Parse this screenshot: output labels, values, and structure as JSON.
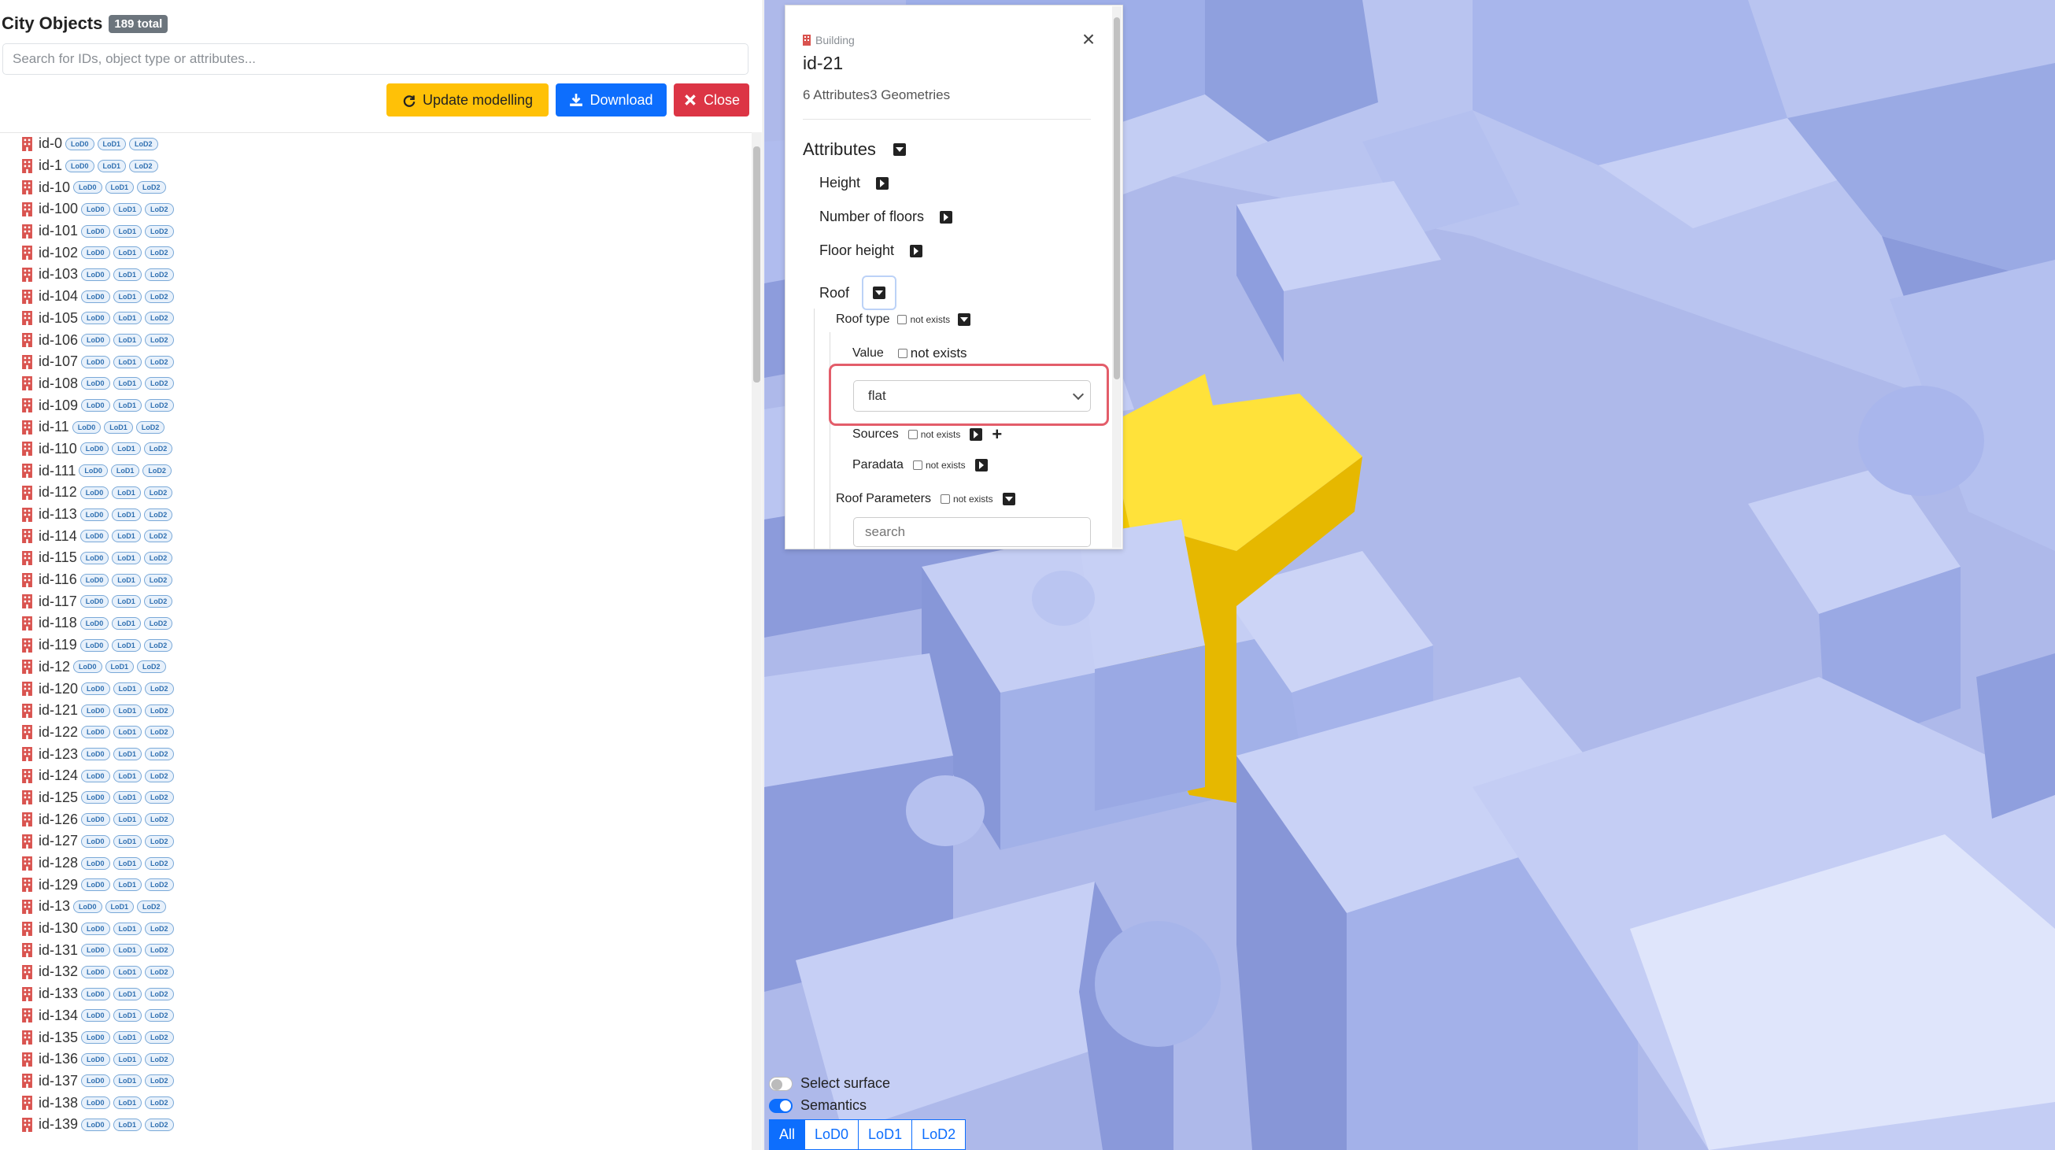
{
  "sidebar": {
    "title": "City Objects",
    "total_badge": "189 total",
    "search_placeholder": "Search for IDs, object type or attributes...",
    "buttons": {
      "update": "Update modelling",
      "download": "Download",
      "close": "Close"
    },
    "lod_labels": [
      "LoD0",
      "LoD1",
      "LoD2"
    ],
    "items": [
      "id-0",
      "id-1",
      "id-10",
      "id-100",
      "id-101",
      "id-102",
      "id-103",
      "id-104",
      "id-105",
      "id-106",
      "id-107",
      "id-108",
      "id-109",
      "id-11",
      "id-110",
      "id-111",
      "id-112",
      "id-113",
      "id-114",
      "id-115",
      "id-116",
      "id-117",
      "id-118",
      "id-119",
      "id-12",
      "id-120",
      "id-121",
      "id-122",
      "id-123",
      "id-124",
      "id-125",
      "id-126",
      "id-127",
      "id-128",
      "id-129",
      "id-13",
      "id-130",
      "id-131",
      "id-132",
      "id-133",
      "id-134",
      "id-135",
      "id-136",
      "id-137",
      "id-138",
      "id-139"
    ]
  },
  "panel": {
    "type": "Building",
    "id": "id-21",
    "attributes_count": "6 Attributes",
    "geometries_count": "3 Geometries",
    "section_title": "Attributes",
    "attributes": {
      "height": "Height",
      "floors": "Number of floors",
      "floor_height": "Floor height",
      "roof": "Roof"
    },
    "roof": {
      "roof_type": "Roof type",
      "value": "Value",
      "value_not_exists": "not exists",
      "selected_value": "flat",
      "sources": "Sources",
      "paradata": "Paradata",
      "roof_parameters": "Roof Parameters",
      "not_exists": "not exists",
      "search_placeholder": "search"
    }
  },
  "viewer": {
    "select_surface": "Select surface",
    "semantics": "Semantics",
    "lod_tabs": [
      "All",
      "LoD0",
      "LoD1",
      "LoD2"
    ],
    "active_tab": "All",
    "colors": {
      "ground": "#aab6e8",
      "building": "#a9b8ee",
      "selected": "#ffd92e"
    }
  }
}
